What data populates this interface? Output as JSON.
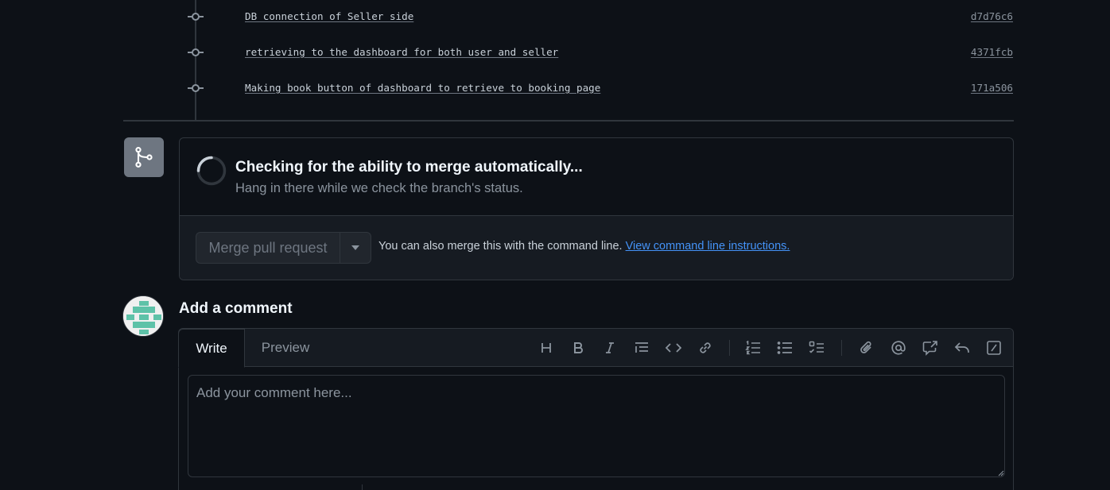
{
  "commits": [
    {
      "message": "DB connection of Seller side",
      "sha": "d7d76c6"
    },
    {
      "message": "retrieving to the dashboard for both user and seller",
      "sha": "4371fcb"
    },
    {
      "message": "Making book button of dashboard to retrieve to booking page",
      "sha": "171a506"
    }
  ],
  "merge": {
    "icon": "git-merge-icon",
    "title": "Checking for the ability to merge automatically...",
    "subtitle": "Hang in there while we check the branch's status.",
    "button_label": "Merge pull request",
    "hint_text": "You can also merge this with the command line.",
    "hint_link": "View command line instructions."
  },
  "comment": {
    "heading": "Add a comment",
    "tabs": [
      {
        "label": "Write",
        "active": true
      },
      {
        "label": "Preview",
        "active": false
      }
    ],
    "placeholder": "Add your comment here...",
    "toolbar_icons": [
      "heading-icon",
      "bold-icon",
      "italic-icon",
      "quote-icon",
      "code-icon",
      "link-icon",
      "ordered-list-icon",
      "unordered-list-icon",
      "task-list-icon",
      "attach-icon",
      "mention-icon",
      "cross-reference-icon",
      "reply-icon",
      "slash-commands-icon"
    ]
  },
  "colors": {
    "background": "#0d1117",
    "border": "#30363d",
    "link": "#4493f8",
    "avatar_accent": "#5ec2a8"
  }
}
